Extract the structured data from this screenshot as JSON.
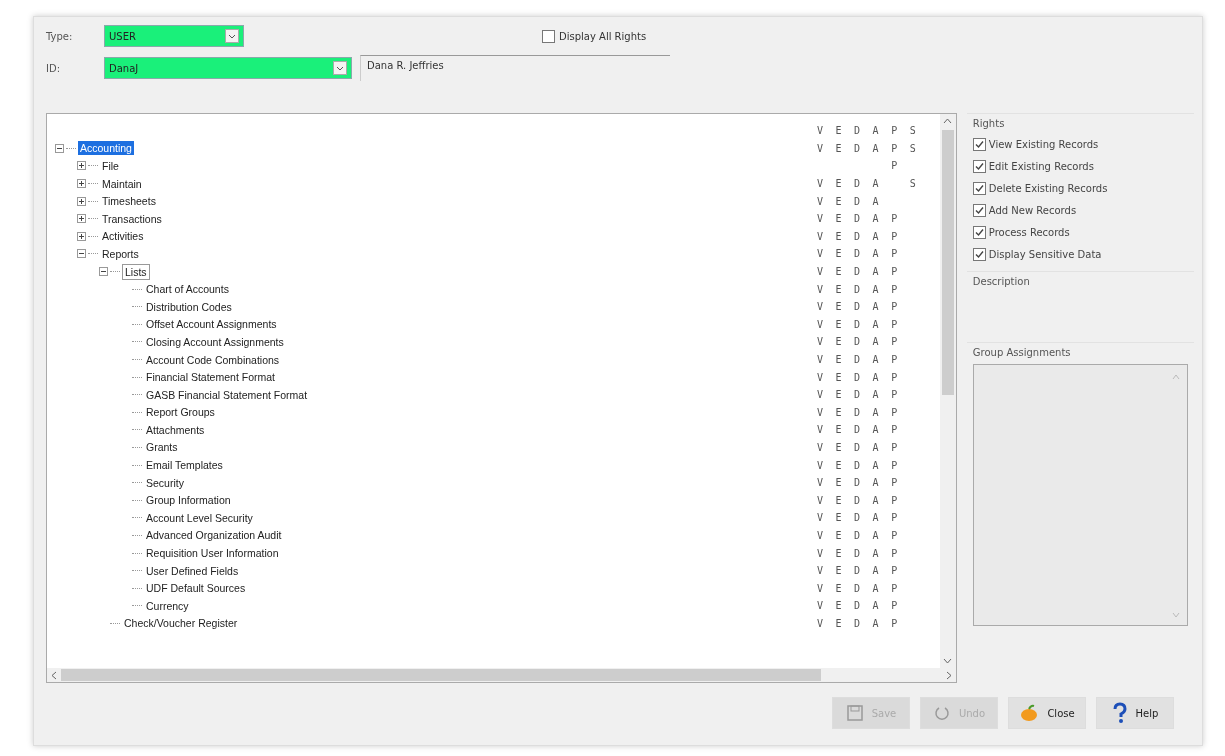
{
  "type_field": {
    "label": "Type:",
    "value": "USER"
  },
  "id_field": {
    "label": "ID:",
    "value": "DanaJ",
    "name": "Dana R. Jeffries"
  },
  "display_all_rights": {
    "label": "Display All Rights",
    "checked": false
  },
  "rights_header": "V E D A P S",
  "tree": [
    {
      "label": "Accounting",
      "selected": true,
      "expanded": true,
      "rights": "V E D A P S",
      "children": [
        {
          "label": "File",
          "selected": false,
          "expanded": false,
          "rights": "        P"
        },
        {
          "label": "Maintain",
          "selected": false,
          "expanded": false,
          "rights": "V E D A   S"
        },
        {
          "label": "Timesheets",
          "selected": false,
          "expanded": false,
          "rights": "V E D A"
        },
        {
          "label": "Transactions",
          "selected": false,
          "expanded": false,
          "rights": "V E D A P"
        },
        {
          "label": "Activities",
          "selected": false,
          "expanded": false,
          "rights": "V E D A P"
        },
        {
          "label": "Reports",
          "selected": false,
          "expanded": true,
          "rights": "V E D A P",
          "children": [
            {
              "label": "Lists",
              "selected": false,
              "expanded": true,
              "rights": "V E D A P",
              "children": [
                {
                  "label": "Chart of Accounts",
                  "selected": false,
                  "rights": "V E D A P"
                },
                {
                  "label": "Distribution Codes",
                  "selected": false,
                  "rights": "V E D A P"
                },
                {
                  "label": "Offset Account Assignments",
                  "selected": false,
                  "rights": "V E D A P"
                },
                {
                  "label": "Closing Account Assignments",
                  "selected": false,
                  "rights": "V E D A P"
                },
                {
                  "label": "Account Code Combinations",
                  "selected": false,
                  "rights": "V E D A P"
                },
                {
                  "label": "Financial Statement Format",
                  "selected": false,
                  "rights": "V E D A P"
                },
                {
                  "label": "GASB Financial Statement Format",
                  "selected": false,
                  "rights": "V E D A P"
                },
                {
                  "label": "Report Groups",
                  "selected": false,
                  "rights": "V E D A P"
                },
                {
                  "label": "Attachments",
                  "selected": false,
                  "rights": "V E D A P"
                },
                {
                  "label": "Grants",
                  "selected": false,
                  "rights": "V E D A P"
                },
                {
                  "label": "Email Templates",
                  "selected": false,
                  "rights": "V E D A P"
                },
                {
                  "label": "Security",
                  "selected": false,
                  "rights": "V E D A P"
                },
                {
                  "label": "Group Information",
                  "selected": false,
                  "rights": "V E D A P"
                },
                {
                  "label": "Account Level Security",
                  "selected": false,
                  "rights": "V E D A P"
                },
                {
                  "label": "Advanced Organization Audit",
                  "selected": false,
                  "rights": "V E D A P"
                },
                {
                  "label": "Requisition User Information",
                  "selected": false,
                  "rights": "V E D A P"
                },
                {
                  "label": "User Defined Fields",
                  "selected": false,
                  "rights": "V E D A P"
                },
                {
                  "label": "UDF Default Sources",
                  "selected": false,
                  "rights": "V E D A P"
                },
                {
                  "label": "Currency",
                  "selected": false,
                  "rights": "V E D A P"
                }
              ]
            },
            {
              "label": "Check/Voucher Register",
              "selected": false,
              "rights": "V E D A P"
            }
          ]
        }
      ]
    }
  ],
  "rights_panel": {
    "title": "Rights",
    "items": [
      {
        "label": "View Existing Records",
        "checked": true
      },
      {
        "label": "Edit Existing Records",
        "checked": true
      },
      {
        "label": "Delete Existing Records",
        "checked": true
      },
      {
        "label": "Add New Records",
        "checked": true
      },
      {
        "label": "Process Records",
        "checked": true
      },
      {
        "label": "Display Sensitive Data",
        "checked": true
      }
    ]
  },
  "description": {
    "title": "Description"
  },
  "group_assignments": {
    "title": "Group Assignments"
  },
  "buttons": [
    {
      "label": "Save",
      "kind": "save",
      "disabled": true
    },
    {
      "label": "Undo",
      "kind": "undo",
      "disabled": true
    },
    {
      "label": "Close",
      "kind": "close",
      "disabled": false
    },
    {
      "label": "Help",
      "kind": "help",
      "disabled": false
    }
  ]
}
